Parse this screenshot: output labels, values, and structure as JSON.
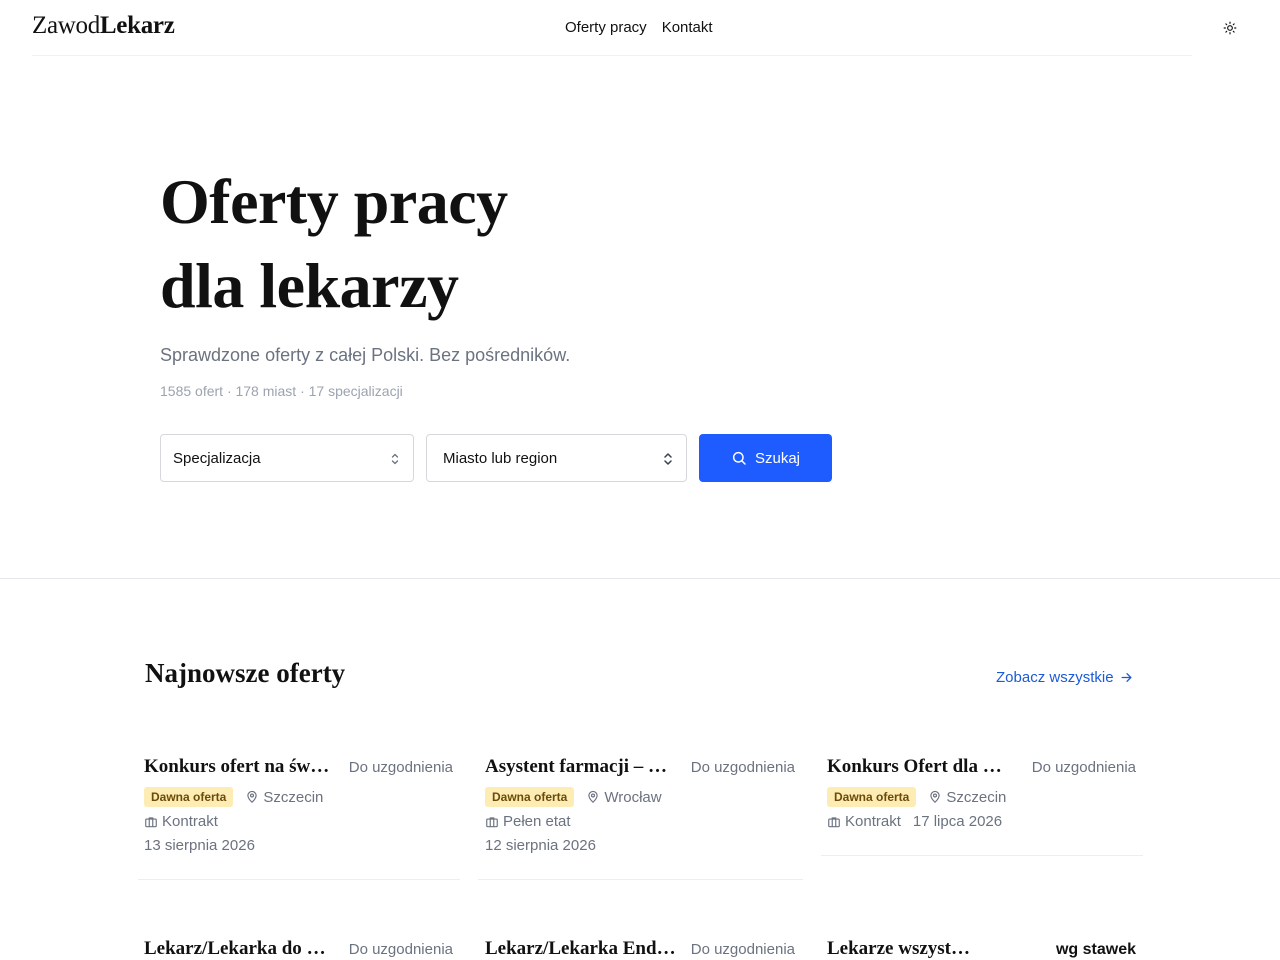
{
  "header": {
    "logo_light": "Zawod",
    "logo_bold": "Lekarz",
    "nav": [
      {
        "label": "Oferty pracy"
      },
      {
        "label": "Kontakt"
      }
    ],
    "theme_icon": "sun-icon"
  },
  "hero": {
    "title_line1": "Oferty pracy",
    "title_line2": "dla lekarzy",
    "subtitle": "Sprawdzone oferty z całej Polski. Bez pośredników.",
    "stats": "1585 ofert · 178 miast · 17 specjalizacji"
  },
  "search": {
    "specialization": "Specjalizacja",
    "city": "Miasto lub region",
    "button": "Szukaj"
  },
  "latest": {
    "title": "Najnowsze oferty",
    "see_all": "Zobacz wszystkie",
    "cards": [
      {
        "title": "Konkurs ofert na świadczenie usług medycznych",
        "salary": "Do uzgodnienia",
        "badge": "Dawna oferta",
        "city": "Szczecin",
        "type": "Kontrakt",
        "date": "13 sierpnia 2026"
      },
      {
        "title": "Asystent farmacji – lekarz",
        "salary": "Do uzgodnienia",
        "badge": "Dawna oferta",
        "city": "Wrocław",
        "type": "Pełen etat",
        "date": "12 sierpnia 2026"
      },
      {
        "title": "Konkurs Ofert dla Lekarzy",
        "salary": "Do uzgodnienia",
        "badge": "Dawna oferta",
        "city": "Szczecin",
        "type": "Kontrakt",
        "date": "17 lipca 2026"
      },
      {
        "title": "Lekarz/Lekarka do przychodni",
        "salary": "Do uzgodnienia"
      },
      {
        "title": "Lekarz/Lekarka Endokrynolog",
        "salary": "Do uzgodnienia"
      },
      {
        "title": "Lekarze wszystkich specjalizacji",
        "salary": "wg stawek"
      }
    ]
  }
}
